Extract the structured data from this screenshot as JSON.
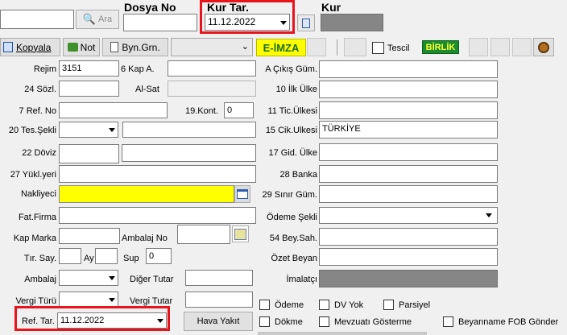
{
  "header": {
    "search_button_label": "Ara",
    "dosya_no_label": "Dosya No",
    "kur_tar_label": "Kur Tar.",
    "kur_tar_value": "11.12.2022",
    "kur_label": "Kur"
  },
  "toolbar": {
    "kopyala_label": "Kopyala",
    "not_label": "Not",
    "byn_grn_label": "Byn.Grn.",
    "eimza_label": "E-İMZA",
    "tescil_label": "Tescil",
    "birlik_label": "BİRLİK"
  },
  "left": {
    "rejim_label": "Rejim",
    "rejim_value": "3151",
    "kap_a_label": "6 Kap A.",
    "sozl_label": "24 Sözl.",
    "al_sat_label": "Al-Sat",
    "ref_no_label": "7 Ref. No",
    "kont_label": "19.Kont.",
    "kont_value": "0",
    "tes_sekli_label": "20 Tes.Şekli",
    "doviz_label": "22 Döviz",
    "yukl_yeri_label": "27 Yükl.yeri",
    "nakliyeci_label": "Nakliyeci",
    "fat_firma_label": "Fat.Firma",
    "kap_marka_label": "Kap Marka",
    "ambalaj_no_label": "Ambalaj No",
    "tir_say_label": "Tır. Say.",
    "ay_label": "Ay",
    "sup_label": "Sup",
    "sup_value": "0",
    "ambalaj_label": "Ambalaj",
    "diger_tutar_label": "Diğer Tutar",
    "vergi_turu_label": "Vergi Türü",
    "vergi_tutar_label": "Vergi Tutar",
    "ref_tar_label": "Ref. Tar.",
    "ref_tar_value": "11.12.2022",
    "hava_yakit_label": "Hava Yakıt"
  },
  "right": {
    "a_cikis_gum_label": "A Çıkış Güm.",
    "ilk_ulke_label": "10 İlk Ülke",
    "tic_ulkesi_label": "11 Tic.Ülkesi",
    "cik_ulkesi_label": "15 Cik.Ulkesi",
    "cik_ulkesi_value": "TÜRKİYE",
    "gid_ulke_label": "17 Gid. Ülke",
    "banka_label": "28 Banka",
    "sinir_gum_label": "29 Sınır Güm.",
    "odeme_sekli_label": "Ödeme Şekli",
    "bey_sah_label": "54 Bey.Sah.",
    "ozet_beyan_label": "Özet Beyan",
    "imalatci_label": "İmalatçı",
    "odeme_chk_label": "Ödeme",
    "dv_yok_label": "DV Yok",
    "parsiyel_label": "Parsiyel",
    "dokme_label": "Dökme",
    "mevzuati_label": "Mevzuatı Gösterme",
    "fob_label": "Beyanname FOB Gönder"
  }
}
